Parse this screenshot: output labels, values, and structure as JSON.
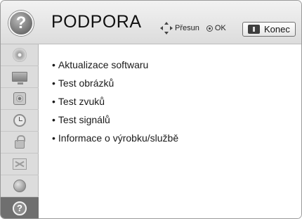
{
  "header": {
    "title": "PODPORA",
    "icon": "help-icon",
    "icon_glyph": "?",
    "hint_move": "Přesun",
    "hint_ok": "OK",
    "exit_label": "Konec"
  },
  "sidebar": {
    "items": [
      {
        "icon": "disc-icon",
        "active": false
      },
      {
        "icon": "screen-icon",
        "active": false
      },
      {
        "icon": "speaker-icon",
        "active": false
      },
      {
        "icon": "clock-icon",
        "active": false
      },
      {
        "icon": "lock-icon",
        "active": false
      },
      {
        "icon": "flag-icon",
        "active": false
      },
      {
        "icon": "globe-icon",
        "active": false
      },
      {
        "icon": "help-icon",
        "active": true,
        "glyph": "?"
      }
    ]
  },
  "menu": {
    "bullet": "•",
    "items": [
      {
        "label": "Aktualizace softwaru"
      },
      {
        "label": "Test obrázků"
      },
      {
        "label": "Test zvuků"
      },
      {
        "label": "Test signálů"
      },
      {
        "label": "Informace o výrobku/službě"
      }
    ]
  },
  "colors": {
    "header_bg": "#e6e6e6",
    "sidebar_bg": "#dcdcdc",
    "active_item_bg": "#6f6f6f",
    "text": "#1a1a1a"
  }
}
